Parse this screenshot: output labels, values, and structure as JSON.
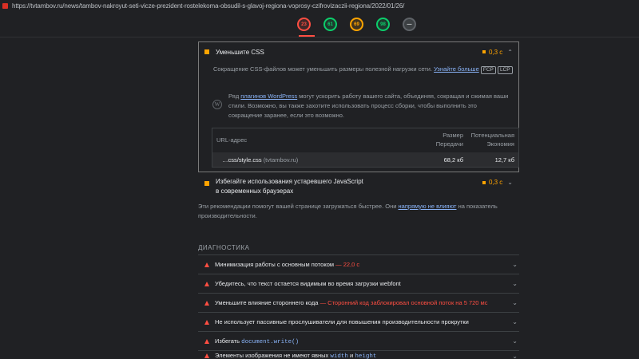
{
  "url": "https://tvtambov.ru/news/tambov-nakroyut-seti-vicze-prezident-rostelekoma-obsudil-s-glavoj-regiona-voprosy-czifrovizaczii-regiona/2022/01/26/",
  "gauges": [
    "23",
    "61",
    "69",
    "98",
    "—"
  ],
  "css": {
    "title": "Уменьшите CSS",
    "saving": "0,3 с",
    "desc": "Сокращение CSS-файлов может уменьшить размеры полезной нагрузки сети.",
    "learn_more": "Узнайте больше",
    "chip_fcp": "FCP",
    "chip_lcp": "LCP",
    "wp_prefix": "Ряд",
    "wp_link": "плагинов WordPress",
    "wp_text": "могут ускорить работу вашего сайта, объединяя, сокращая и сжимая ваши стили. Возможно, вы также захотите использовать процесс сборки, чтобы выполнить это сокращение заранее, если это возможно.",
    "col_url": "URL-адрес",
    "col_size_1": "Размер",
    "col_size_2": "Передачи",
    "col_save_1": "Потенциальная",
    "col_save_2": "Экономия",
    "row_url": "…css/style.css",
    "row_host": "(tvtambov.ru)",
    "row_size": "68,2 кб",
    "row_save": "12,7 кб"
  },
  "js": {
    "title": "Избегайте использования устаревшего JavaScript в современных браузерах",
    "saving": "0,3 с"
  },
  "note": {
    "text_1": "Эти рекомендации помогут вашей странице загружаться быстрее. Они",
    "link": "напрямую не влияют",
    "text_2": "на показатель производительности."
  },
  "diagnostics": {
    "title": "ДИАГНОСТИКА",
    "items": [
      {
        "text": "Минимизация работы с основным потоком",
        "extra": "— 22,0 с"
      },
      {
        "text": "Убедитесь, что текст остается видимым во время загрузки webfont",
        "extra": ""
      },
      {
        "text": "Уменьшите влияние стороннего кода",
        "extra": "— Сторонний код заблокировал основной поток на 5 720 мс"
      },
      {
        "text": "Не использует пассивные прослушиватели для повышения производительности прокрутки",
        "extra": ""
      },
      {
        "text": "Избегать",
        "code": "document.write()"
      },
      {
        "text": "Элементы изображения не имеют явных",
        "code1": "width",
        "mid": "и",
        "code2": "height"
      }
    ]
  }
}
